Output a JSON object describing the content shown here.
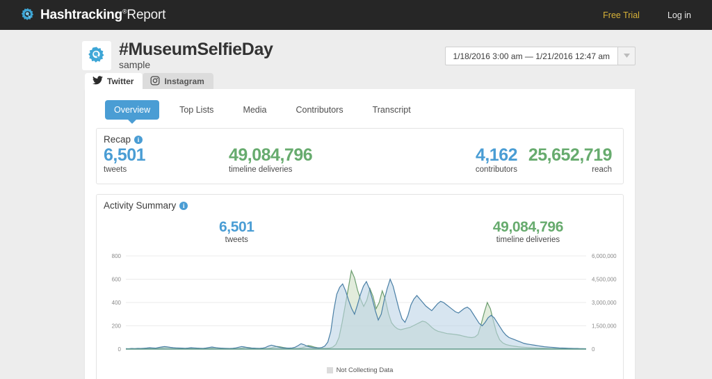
{
  "topbar": {
    "brand_bold": "Hashtracking",
    "brand_reg": "®",
    "brand_light": "Report",
    "logo_icon": "gear-search-icon",
    "free_trial": "Free Trial",
    "log_in": "Log in",
    "trial_color": "#d8b238",
    "bg_color": "#262626"
  },
  "header": {
    "logo_icon": "gear-icon",
    "hashtag": "#MuseumSelfieDay",
    "subtitle": "sample",
    "date_range": "1/18/2016 3:00 am — 1/21/2016 12:47 am",
    "dropdown_icon": "chevron-down-icon"
  },
  "channel_tabs": [
    {
      "label": "Twitter",
      "icon": "twitter-bird-icon",
      "active": true
    },
    {
      "label": "Instagram",
      "icon": "instagram-camera-icon",
      "active": false
    }
  ],
  "sub_tabs": [
    {
      "label": "Overview",
      "active": true
    },
    {
      "label": "Top Lists",
      "active": false
    },
    {
      "label": "Media",
      "active": false
    },
    {
      "label": "Contributors",
      "active": false
    },
    {
      "label": "Transcript",
      "active": false
    }
  ],
  "recap": {
    "title": "Recap",
    "info_icon": "info-icon",
    "stats": [
      {
        "value": "6,501",
        "label": "tweets",
        "color": "#4a9dd4"
      },
      {
        "value": "49,084,796",
        "label": "timeline deliveries",
        "color": "#67ab6e"
      },
      {
        "value": "4,162",
        "label": "contributors",
        "color": "#4a9dd4"
      },
      {
        "value": "25,652,719",
        "label": "reach",
        "color": "#67ab6e"
      }
    ]
  },
  "activity": {
    "title": "Activity Summary",
    "info_icon": "info-icon",
    "stats": [
      {
        "value": "6,501",
        "label": "tweets",
        "color": "#4a9dd4"
      },
      {
        "value": "49,084,796",
        "label": "timeline deliveries",
        "color": "#67ab6e"
      }
    ],
    "legend_label": "Not Collecting Data",
    "legend_swatch_color": "#dcdcdc"
  },
  "chart_data": {
    "type": "area",
    "title": "Activity Summary",
    "xlabel": "",
    "ylabel": "tweets",
    "y2label": "timeline deliveries",
    "grid": true,
    "legend": [
      "Not Collecting Data"
    ],
    "left_axis": {
      "ticks": [
        0,
        200,
        400,
        600,
        800
      ],
      "labels": [
        "0",
        "200",
        "400",
        "600",
        "800"
      ],
      "ylim": [
        0,
        800
      ],
      "color": "#4a9dd4"
    },
    "right_axis": {
      "ticks": [
        0,
        1500000,
        3000000,
        4500000,
        6000000
      ],
      "labels": [
        "0",
        "1,500,000",
        "3,000,000",
        "4,500,000",
        "6,000,000"
      ],
      "ylim": [
        0,
        6000000
      ],
      "color": "#67ab6e"
    },
    "series": [
      {
        "name": "tweets",
        "axis": "left",
        "color": "#4a7fa5",
        "fill": "#bcd4e6",
        "values": [
          4,
          3,
          5,
          4,
          6,
          5,
          7,
          9,
          12,
          10,
          8,
          14,
          18,
          22,
          19,
          15,
          12,
          10,
          9,
          8,
          7,
          9,
          12,
          10,
          8,
          7,
          6,
          9,
          14,
          18,
          14,
          10,
          8,
          7,
          6,
          5,
          7,
          10,
          16,
          22,
          18,
          12,
          9,
          8,
          7,
          6,
          8,
          14,
          26,
          34,
          28,
          20,
          14,
          10,
          9,
          8,
          10,
          16,
          30,
          46,
          38,
          26,
          18,
          13,
          11,
          10,
          14,
          26,
          60,
          150,
          330,
          470,
          530,
          560,
          500,
          420,
          350,
          300,
          380,
          470,
          540,
          580,
          520,
          430,
          330,
          250,
          300,
          420,
          520,
          600,
          540,
          440,
          340,
          260,
          230,
          290,
          380,
          430,
          460,
          430,
          400,
          370,
          350,
          330,
          360,
          390,
          410,
          400,
          380,
          360,
          340,
          320,
          310,
          330,
          350,
          360,
          340,
          300,
          260,
          220,
          200,
          230,
          270,
          290,
          270,
          230,
          190,
          150,
          120,
          100,
          90,
          80,
          70,
          60,
          50,
          44,
          40,
          36,
          32,
          28,
          24,
          20,
          18,
          16,
          14,
          12,
          10,
          9,
          8,
          7,
          6,
          5,
          5,
          4,
          4,
          3
        ]
      },
      {
        "name": "timeline deliveries",
        "axis": "right",
        "color": "#6b9d6e",
        "fill": "#cfe0c4",
        "values": [
          20000,
          18000,
          25000,
          22000,
          30000,
          28000,
          35000,
          45000,
          60000,
          50000,
          40000,
          70000,
          90000,
          110000,
          95000,
          75000,
          60000,
          50000,
          45000,
          40000,
          35000,
          45000,
          60000,
          50000,
          40000,
          35000,
          30000,
          45000,
          70000,
          90000,
          70000,
          50000,
          40000,
          35000,
          30000,
          25000,
          35000,
          50000,
          80000,
          110000,
          90000,
          60000,
          45000,
          40000,
          35000,
          30000,
          40000,
          70000,
          130000,
          170000,
          140000,
          100000,
          70000,
          50000,
          45000,
          40000,
          50000,
          80000,
          150000,
          230000,
          190000,
          130000,
          90000,
          65000,
          55000,
          50000,
          70000,
          130000,
          300000,
          750000,
          1700000,
          2800000,
          3900000,
          5050000,
          4600000,
          3800000,
          3200000,
          2750000,
          3150000,
          3900000,
          3400000,
          2600000,
          3000000,
          3750000,
          3200000,
          2300000,
          1700000,
          1450000,
          1300000,
          1250000,
          1300000,
          1350000,
          1400000,
          1500000,
          1600000,
          1700000,
          1800000,
          1750000,
          1600000,
          1400000,
          1250000,
          1150000,
          1100000,
          1050000,
          1000000,
          980000,
          960000,
          930000,
          900000,
          850000,
          800000,
          760000,
          740000,
          780000,
          950000,
          1600000,
          2350000,
          3000000,
          2600000,
          1800000,
          1050000,
          600000,
          400000,
          300000,
          250000,
          210000,
          180000,
          150000,
          130000,
          115000,
          100000,
          90000,
          80000,
          70000,
          60000,
          55000,
          48000,
          42000,
          36000,
          30000,
          26000,
          22000,
          18000,
          15000,
          13000,
          11000,
          9000,
          8000,
          7000,
          6000
        ]
      }
    ]
  }
}
